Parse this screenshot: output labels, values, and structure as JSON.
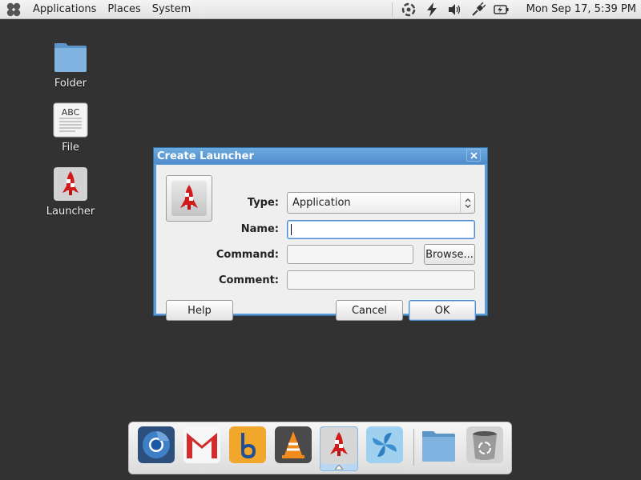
{
  "top_panel": {
    "menus": [
      "Applications",
      "Places",
      "System"
    ],
    "tray_icons": [
      "update-icon",
      "power-bolt-icon",
      "volume-icon",
      "network-plug-icon",
      "battery-icon"
    ],
    "clock": "Mon Sep 17,  5:39 PM"
  },
  "desktop": {
    "icons": [
      {
        "label": "Folder",
        "icon": "folder-icon"
      },
      {
        "label": "File",
        "icon": "text-file-icon",
        "preview_text": "ABC"
      },
      {
        "label": "Launcher",
        "icon": "rocket-icon"
      }
    ]
  },
  "dialog": {
    "title": "Create Launcher",
    "fields": {
      "type_label": "Type:",
      "type_value": "Application",
      "name_label": "Name:",
      "name_value": "",
      "command_label": "Command:",
      "command_value": "",
      "comment_label": "Comment:",
      "comment_value": ""
    },
    "buttons": {
      "browse": "Browse...",
      "help": "Help",
      "cancel": "Cancel",
      "ok": "OK"
    }
  },
  "dock": {
    "items": [
      {
        "name": "chromium-icon"
      },
      {
        "name": "gmail-icon"
      },
      {
        "name": "bibble-icon"
      },
      {
        "name": "vlc-icon"
      },
      {
        "name": "launcher-rocket-icon",
        "active": true
      },
      {
        "name": "pinwheel-icon"
      },
      {
        "name": "folder-icon"
      },
      {
        "name": "trash-icon"
      }
    ]
  },
  "colors": {
    "desktop_bg": "#323232",
    "title_blue": "#5a9bd6",
    "rocket_red": "#d11b1b"
  }
}
